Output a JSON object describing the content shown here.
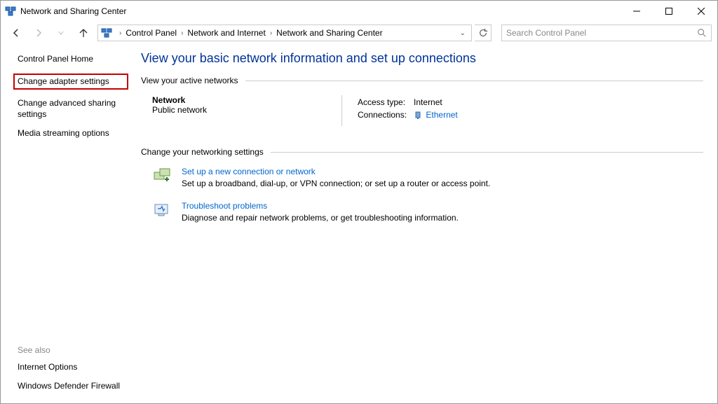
{
  "window": {
    "title": "Network and Sharing Center"
  },
  "breadcrumb": {
    "part1": "Control Panel",
    "part2": "Network and Internet",
    "part3": "Network and Sharing Center"
  },
  "search": {
    "placeholder": "Search Control Panel"
  },
  "sidebar": {
    "home": "Control Panel Home",
    "adapter": "Change adapter settings",
    "sharing": "Change advanced sharing settings",
    "media": "Media streaming options"
  },
  "seealso": {
    "heading": "See also",
    "internet": "Internet Options",
    "firewall": "Windows Defender Firewall"
  },
  "content": {
    "heading": "View your basic network information and set up connections",
    "active_heading": "View your active networks",
    "network_name": "Network",
    "network_type": "Public network",
    "access_label": "Access type:",
    "access_value": "Internet",
    "conn_label": "Connections:",
    "conn_value": "Ethernet",
    "change_heading": "Change your networking settings",
    "setup_title": "Set up a new connection or network",
    "setup_desc": "Set up a broadband, dial-up, or VPN connection; or set up a router or access point.",
    "troubleshoot_title": "Troubleshoot problems",
    "troubleshoot_desc": "Diagnose and repair network problems, or get troubleshooting information."
  }
}
